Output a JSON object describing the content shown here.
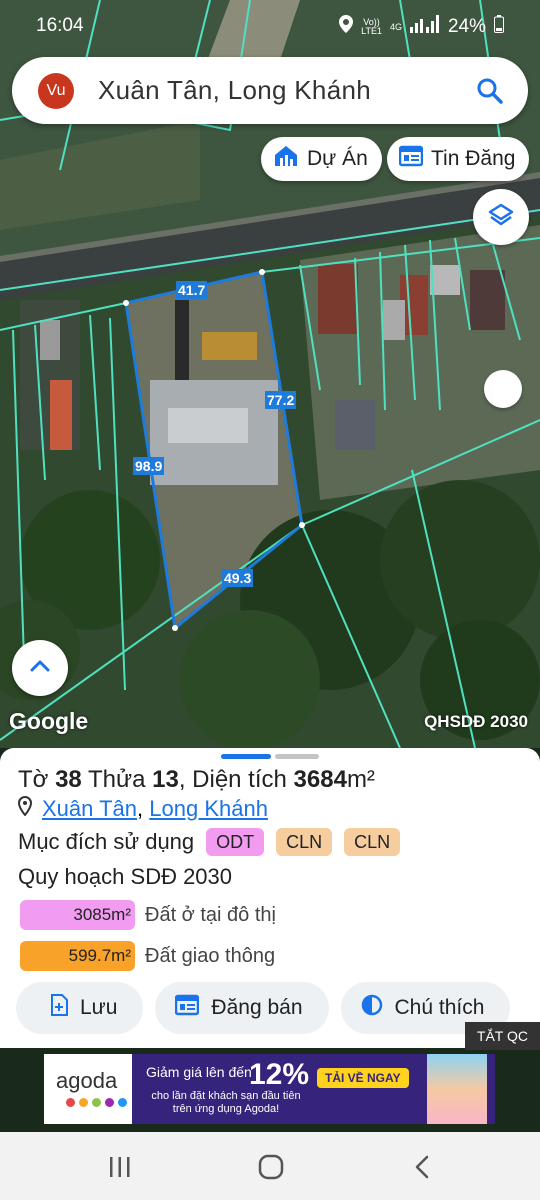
{
  "status": {
    "time": "16:04",
    "network_top": "Vo))",
    "network_bottom": "LTE1",
    "net_type": "4G",
    "battery": "24%"
  },
  "search": {
    "avatar_initials": "Vu",
    "query": "Xuân Tân, Long Khánh"
  },
  "chips": {
    "projects": "Dự Án",
    "listings": "Tin Đăng"
  },
  "map": {
    "edges": {
      "top": "41.7",
      "right": "77.2",
      "left": "98.9",
      "bottom": "49.3"
    },
    "attribution": "Google",
    "layer_label": "QHSDĐ 2030"
  },
  "parcel": {
    "sheet_label": "Tờ",
    "sheet_no": "38",
    "lot_label": "Thửa",
    "lot_no": "13",
    "area_label": "Diện tích",
    "area_value": "3684",
    "area_unit": "m²",
    "commune": "Xuân Tân",
    "separator": ",",
    "city": "Long Khánh",
    "purpose_label": "Mục đích sử dụng",
    "purpose_tags": [
      "ODT",
      "CLN",
      "CLN"
    ],
    "plan_title": "Quy hoạch SDĐ 2030",
    "plan": [
      {
        "area": "3085m²",
        "label": "Đất ở tại đô thị",
        "color": "#f19cf0"
      },
      {
        "area": "599.7m²",
        "label": "Đất giao thông",
        "color": "#f9a22a"
      }
    ]
  },
  "actions": {
    "save": "Lưu",
    "sell": "Đăng bán",
    "legend": "Chú thích"
  },
  "ad_toggle": "TẮT QC",
  "ad": {
    "brand": "agoda",
    "headline": "Giảm giá lên đến",
    "percent": "12%",
    "cta": "TẢI VỀ NGAY",
    "subline": "cho lần đặt khách sạn đầu tiên trên ứng dụng Agoda!"
  },
  "colors": {
    "accent": "#1a73e8",
    "parcel_outline": "#1e7bd9",
    "boundary": "#4fe0c0",
    "avatar": "#c8371d"
  }
}
